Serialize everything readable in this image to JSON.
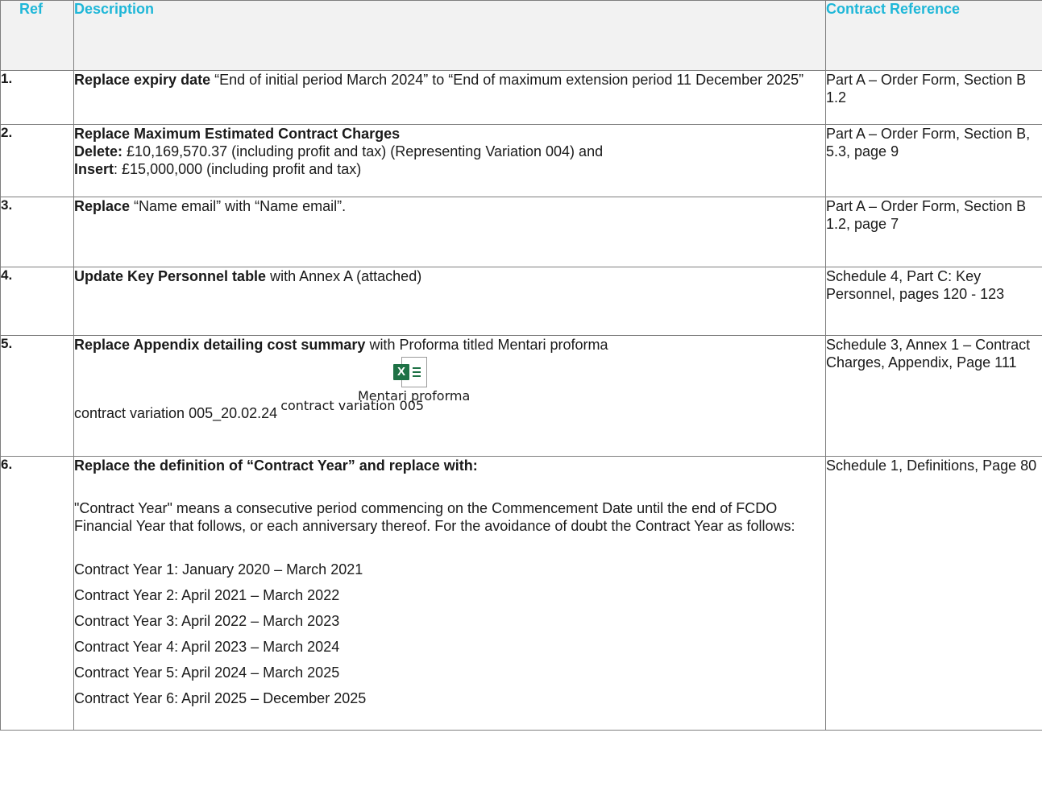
{
  "headers": {
    "ref": "Ref",
    "description": "Description",
    "contract_reference": "Contract Reference"
  },
  "rows": [
    {
      "ref": "1.",
      "bold": "Replace expiry date",
      "text": " “End of initial period March 2024” to “End of maximum extension period 11 December 2025”",
      "contract_ref": "Part A – Order Form, Section B 1.2"
    },
    {
      "ref": "2.",
      "bold": "Replace Maximum Estimated Contract Charges",
      "delete_label": "Delete:",
      "delete_text": " £10,169,570.37 (including profit and tax) (Representing Variation 004) and",
      "insert_label": "Insert",
      "insert_text": ": £15,000,000 (including profit and tax)",
      "contract_ref": "Part A – Order Form, Section B, 5.3, page 9"
    },
    {
      "ref": "3.",
      "bold": "Replace",
      "text": " “Name email” with “Name email”.",
      "contract_ref": "Part A – Order Form, Section B 1.2, page 7"
    },
    {
      "ref": "4.",
      "bold": "Update Key Personnel table",
      "text": " with Annex A (attached)",
      "contract_ref": "Schedule 4, Part C: Key Personnel, pages 120 - 123"
    },
    {
      "ref": "5.",
      "bold": "Replace Appendix detailing cost summary",
      "text": " with Proforma titled Mentari proforma",
      "icon": "excel-file-icon",
      "icon_letter": "X",
      "attachment_caption_1": "Mentari proforma",
      "attachment_caption_2": "contract variation 005",
      "file_line": "contract variation 005_20.02.24",
      "contract_ref": "Schedule 3, Annex 1 – Contract Charges, Appendix, Page 111"
    },
    {
      "ref": "6.",
      "bold": "Replace the definition of “Contract Year” and replace with:",
      "definition": "\"Contract Year\" means a consecutive period commencing on the Commencement Date until the end of FCDO Financial Year that follows, or each anniversary thereof. For the avoidance of doubt the Contract Year as follows:",
      "years": [
        "Contract Year 1: January 2020 – March 2021",
        "Contract Year 2: April 2021 – March 2022",
        "Contract Year 3: April 2022 – March 2023",
        "Contract Year 4: April 2023 – March 2024",
        "Contract Year 5: April 2024 – March 2025",
        "Contract Year 6: April 2025 – December 2025"
      ],
      "contract_ref": "Schedule 1, Definitions, Page 80"
    }
  ]
}
